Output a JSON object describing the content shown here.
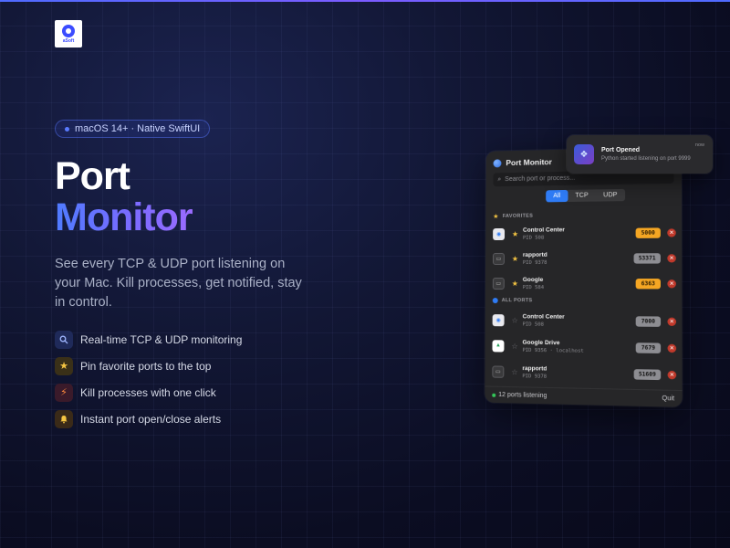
{
  "brand": {
    "logo_text": "aSoft"
  },
  "hero": {
    "badge": "macOS 14+ · Native SwiftUI",
    "title_line1": "Port",
    "title_line2": "Monitor",
    "description": "See every TCP & UDP port listening on your Mac. Kill processes, get notified, stay in control."
  },
  "features": [
    {
      "icon": "search-icon",
      "label": "Real-time TCP & UDP monitoring"
    },
    {
      "icon": "star-icon",
      "label": "Pin favorite ports to the top"
    },
    {
      "icon": "lightning-icon",
      "label": "Kill processes with one click"
    },
    {
      "icon": "bell-icon",
      "label": "Instant port open/close alerts"
    }
  ],
  "app": {
    "title": "Port Monitor",
    "search_placeholder": "Search port or process...",
    "segments": [
      "All",
      "TCP",
      "UDP"
    ],
    "selected_segment": "All",
    "favorites_label": "FAVORITES",
    "all_ports_label": "ALL PORTS",
    "favorites": [
      {
        "name": "Control Center",
        "sub": "PID 508",
        "port": "5000",
        "color": "orange",
        "starred": true
      },
      {
        "name": "rapportd",
        "sub": "PID 9378",
        "port": "53371",
        "color": "gray",
        "starred": true
      },
      {
        "name": "Google",
        "sub": "PID 584",
        "port": "6363",
        "color": "orange",
        "starred": true
      }
    ],
    "all_ports": [
      {
        "name": "Control Center",
        "sub": "PID 508",
        "port": "7000",
        "color": "gray",
        "starred": false
      },
      {
        "name": "Google Drive",
        "sub": "PID 9356 · localhost",
        "port": "7679",
        "color": "gray",
        "starred": false
      },
      {
        "name": "rapportd",
        "sub": "PID 9378",
        "port": "51609",
        "color": "gray",
        "starred": false
      }
    ],
    "footer_status": "12 ports listening",
    "quit_label": "Quit"
  },
  "notification": {
    "title": "Port Opened",
    "text": "Python started listening on port 9999",
    "time": "now"
  },
  "colors": {
    "accent": "#2f7cf6",
    "port_orange": "#f5a623",
    "kill_red": "#c0392b",
    "title_gradient_start": "#4f7bff",
    "title_gradient_end": "#9a6bff"
  }
}
